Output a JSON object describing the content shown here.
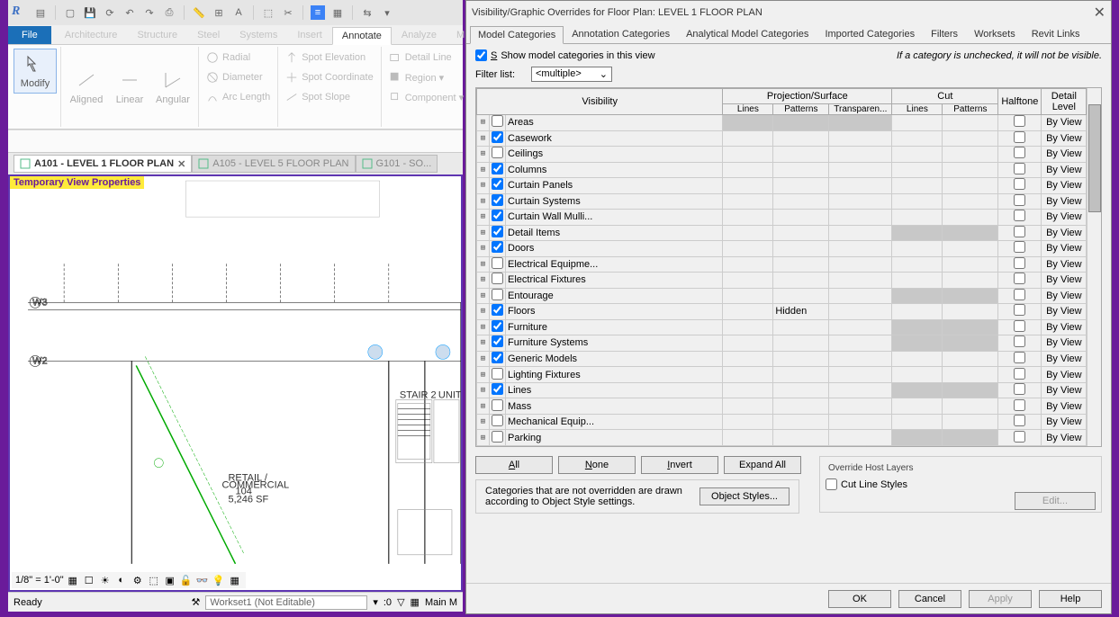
{
  "ribbon": {
    "tabs": [
      "File",
      "Architecture",
      "Structure",
      "Steel",
      "Systems",
      "Insert",
      "Annotate",
      "Analyze",
      "M..."
    ],
    "active": "Annotate",
    "modify": "Modify",
    "dims": [
      "Aligned",
      "Linear",
      "Angular"
    ],
    "dims2": [
      "Radial",
      "Diameter",
      "Arc Length"
    ],
    "dims3": [
      "Spot Elevation",
      "Spot Coordinate",
      "Spot Slope"
    ],
    "detail": [
      "Detail Line",
      "Region ▾",
      "Component ▾"
    ]
  },
  "doctabs": {
    "t0": "A101 - LEVEL 1 FLOOR PLAN",
    "t1": "A105 - LEVEL 5 FLOOR PLAN",
    "t2": "G101 - SO..."
  },
  "tvp": "Temporary View Properties",
  "scale": "1/8\" = 1'-0\"",
  "status": {
    "ready": "Ready",
    "workset": "Workset1 (Not Editable)",
    "sel": ":0",
    "main": "Main M"
  },
  "dlg": {
    "title": "Visibility/Graphic Overrides for Floor Plan: LEVEL 1 FLOOR PLAN",
    "tabs": [
      "Model Categories",
      "Annotation Categories",
      "Analytical Model Categories",
      "Imported Categories",
      "Filters",
      "Worksets",
      "Revit Links"
    ],
    "show": "Show model categories in this view",
    "note": "If a category is unchecked, it will not be visible.",
    "filterlbl": "Filter list:",
    "filter": "<multiple>",
    "hdr": {
      "vis": "Visibility",
      "proj": "Projection/Surface",
      "cut": "Cut",
      "ht": "Halftone",
      "dl": "Detail Level",
      "lines": "Lines",
      "patterns": "Patterns",
      "trans": "Transparen...",
      "clines": "Lines",
      "cpat": "Patterns"
    },
    "rows": [
      {
        "c": false,
        "n": "Areas",
        "sc": true,
        "dl": "By View"
      },
      {
        "c": true,
        "n": "Casework",
        "sc": true,
        "dl": "By View"
      },
      {
        "c": false,
        "n": "Ceilings",
        "sc": true,
        "dl": "By View"
      },
      {
        "c": true,
        "n": "Columns",
        "sc": true,
        "dl": "By View"
      },
      {
        "c": true,
        "n": "Curtain Panels",
        "sc": true,
        "dl": "By View"
      },
      {
        "c": true,
        "n": "Curtain Systems",
        "sc": true,
        "dl": "By View"
      },
      {
        "c": true,
        "n": "Curtain Wall Mulli...",
        "sc": true,
        "dl": "By View"
      },
      {
        "c": true,
        "n": "Detail Items",
        "sc": false,
        "dl": "By View"
      },
      {
        "c": true,
        "n": "Doors",
        "sc": true,
        "dl": "By View"
      },
      {
        "c": false,
        "n": "Electrical Equipme...",
        "sc": true,
        "dl": "By View"
      },
      {
        "c": false,
        "n": "Electrical Fixtures",
        "sc": true,
        "dl": "By View"
      },
      {
        "c": false,
        "n": "Entourage",
        "sc": false,
        "dl": "By View"
      },
      {
        "c": true,
        "n": "Floors",
        "pat": "Hidden",
        "sc": true,
        "dl": "By View"
      },
      {
        "c": true,
        "n": "Furniture",
        "sc": false,
        "dl": "By View"
      },
      {
        "c": true,
        "n": "Furniture Systems",
        "sc": false,
        "dl": "By View"
      },
      {
        "c": true,
        "n": "Generic Models",
        "sc": true,
        "dl": "By View"
      },
      {
        "c": false,
        "n": "Lighting Fixtures",
        "sc": true,
        "dl": "By View"
      },
      {
        "c": true,
        "n": "Lines",
        "sc": false,
        "dl": "By View"
      },
      {
        "c": false,
        "n": "Mass",
        "sc": true,
        "dl": "By View"
      },
      {
        "c": false,
        "n": "Mechanical Equip...",
        "sc": true,
        "dl": "By View"
      },
      {
        "c": false,
        "n": "Parking",
        "sc": false,
        "dl": "By View"
      }
    ],
    "sel": {
      "all": "All",
      "none": "None",
      "inv": "Invert",
      "exp": "Expand All"
    },
    "host": {
      "t": "Override Host Layers",
      "cut": "Cut Line Styles",
      "edit": "Edit..."
    },
    "objtxt": "Categories that are not overridden are drawn according to Object Style settings.",
    "objbtn": "Object Styles...",
    "ok": "OK",
    "cancel": "Cancel",
    "apply": "Apply",
    "help": "Help"
  }
}
